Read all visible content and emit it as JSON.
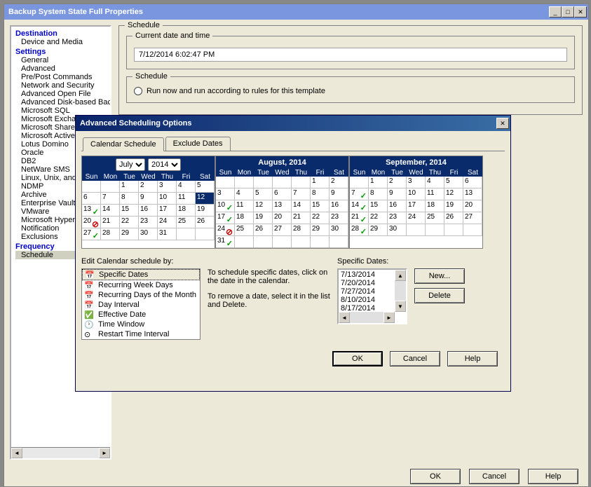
{
  "main": {
    "title": "Backup System State Full Properties",
    "groups": {
      "schedule": "Schedule",
      "datetime_label": "Current date and time",
      "datetime_value": "7/12/2014 6:02:47 PM",
      "schedule2": "Schedule",
      "radio_text": "Run now and run according to rules for this template"
    },
    "buttons": {
      "ok": "OK",
      "cancel": "Cancel",
      "help": "Help"
    }
  },
  "tree": {
    "h1": "Destination",
    "i1": "Device and Media",
    "h2": "Settings",
    "i2": "General",
    "i3": "Advanced",
    "i4": "Pre/Post Commands",
    "i5": "Network and Security",
    "i6": "Advanced Open File",
    "i7": "Advanced Disk-based Backup",
    "i8": "Microsoft SQL",
    "i9": "Microsoft Exchange",
    "i10": "Microsoft SharePoint",
    "i11": "Microsoft Active Directory",
    "i12": "Lotus Domino",
    "i13": "Oracle",
    "i14": "DB2",
    "i15": "NetWare SMS",
    "i16": "Linux, Unix, and Macintosh",
    "i17": "NDMP",
    "i18": "Archive",
    "i19": "Enterprise Vault",
    "i20": "VMware",
    "i21": "Microsoft Hyper-V",
    "i22": "Notification",
    "i23": "Exclusions",
    "h3": "Frequency",
    "i24": "Schedule"
  },
  "dialog": {
    "title": "Advanced Scheduling Options",
    "tabs": {
      "cal": "Calendar Schedule",
      "excl": "Exclude Dates"
    },
    "month_sel": "July",
    "year_sel": "2014",
    "cal2_head": "August, 2014",
    "cal3_head": "September, 2014",
    "dow": [
      "Sun",
      "Mon",
      "Tue",
      "Wed",
      "Thu",
      "Fri",
      "Sat"
    ],
    "calendars": [
      {
        "weeks": [
          [
            {
              "n": ""
            },
            {
              "n": ""
            },
            {
              "n": "1"
            },
            {
              "n": "2"
            },
            {
              "n": "3"
            },
            {
              "n": "4"
            },
            {
              "n": "5"
            }
          ],
          [
            {
              "n": "6"
            },
            {
              "n": "7"
            },
            {
              "n": "8"
            },
            {
              "n": "9"
            },
            {
              "n": "10"
            },
            {
              "n": "11"
            },
            {
              "n": "12",
              "today": true
            }
          ],
          [
            {
              "n": "13",
              "chk": true
            },
            {
              "n": "14"
            },
            {
              "n": "15"
            },
            {
              "n": "16"
            },
            {
              "n": "17"
            },
            {
              "n": "18"
            },
            {
              "n": "19"
            }
          ],
          [
            {
              "n": "20",
              "no": true
            },
            {
              "n": "21"
            },
            {
              "n": "22"
            },
            {
              "n": "23"
            },
            {
              "n": "24"
            },
            {
              "n": "25"
            },
            {
              "n": "26"
            }
          ],
          [
            {
              "n": "27",
              "chk": true
            },
            {
              "n": "28"
            },
            {
              "n": "29"
            },
            {
              "n": "30"
            },
            {
              "n": "31"
            },
            {
              "n": ""
            },
            {
              "n": ""
            }
          ]
        ]
      },
      {
        "weeks": [
          [
            {
              "n": ""
            },
            {
              "n": ""
            },
            {
              "n": ""
            },
            {
              "n": ""
            },
            {
              "n": ""
            },
            {
              "n": "1"
            },
            {
              "n": "2"
            }
          ],
          [
            {
              "n": "3"
            },
            {
              "n": "4"
            },
            {
              "n": "5"
            },
            {
              "n": "6"
            },
            {
              "n": "7"
            },
            {
              "n": "8"
            },
            {
              "n": "9"
            }
          ],
          [
            {
              "n": "10",
              "chk": true
            },
            {
              "n": "11"
            },
            {
              "n": "12"
            },
            {
              "n": "13"
            },
            {
              "n": "14"
            },
            {
              "n": "15"
            },
            {
              "n": "16"
            }
          ],
          [
            {
              "n": "17",
              "chk": true
            },
            {
              "n": "18"
            },
            {
              "n": "19"
            },
            {
              "n": "20"
            },
            {
              "n": "21"
            },
            {
              "n": "22"
            },
            {
              "n": "23"
            }
          ],
          [
            {
              "n": "24",
              "no": true
            },
            {
              "n": "25"
            },
            {
              "n": "26"
            },
            {
              "n": "27"
            },
            {
              "n": "28"
            },
            {
              "n": "29"
            },
            {
              "n": "30"
            }
          ],
          [
            {
              "n": "31",
              "chk": true
            },
            {
              "n": ""
            },
            {
              "n": ""
            },
            {
              "n": ""
            },
            {
              "n": ""
            },
            {
              "n": ""
            },
            {
              "n": ""
            }
          ]
        ]
      },
      {
        "weeks": [
          [
            {
              "n": ""
            },
            {
              "n": "1"
            },
            {
              "n": "2"
            },
            {
              "n": "3"
            },
            {
              "n": "4"
            },
            {
              "n": "5"
            },
            {
              "n": "6"
            }
          ],
          [
            {
              "n": "7",
              "chk": true
            },
            {
              "n": "8"
            },
            {
              "n": "9"
            },
            {
              "n": "10"
            },
            {
              "n": "11"
            },
            {
              "n": "12"
            },
            {
              "n": "13"
            }
          ],
          [
            {
              "n": "14",
              "chk": true
            },
            {
              "n": "15"
            },
            {
              "n": "16"
            },
            {
              "n": "17"
            },
            {
              "n": "18"
            },
            {
              "n": "19"
            },
            {
              "n": "20"
            }
          ],
          [
            {
              "n": "21",
              "chk": true
            },
            {
              "n": "22"
            },
            {
              "n": "23"
            },
            {
              "n": "24"
            },
            {
              "n": "25"
            },
            {
              "n": "26"
            },
            {
              "n": "27"
            }
          ],
          [
            {
              "n": "28",
              "chk": true
            },
            {
              "n": "29"
            },
            {
              "n": "30"
            },
            {
              "n": ""
            },
            {
              "n": ""
            },
            {
              "n": ""
            },
            {
              "n": ""
            }
          ]
        ]
      }
    ],
    "editby_label": "Edit Calendar schedule by:",
    "editby": {
      "o1": "Specific Dates",
      "o2": "Recurring Week Days",
      "o3": "Recurring Days of the Month",
      "o4": "Day Interval",
      "o5": "Effective Date",
      "o6": "Time Window",
      "o7": "Restart Time Interval"
    },
    "hint1": "To schedule specific dates, click on the date in the calendar.",
    "hint2": "To remove a date, select it in the list and Delete.",
    "spec_label": "Specific Dates:",
    "spec_dates": [
      "7/13/2014",
      "7/20/2014",
      "7/27/2014",
      "8/10/2014",
      "8/17/2014"
    ],
    "buttons": {
      "new": "New...",
      "delete": "Delete",
      "ok": "OK",
      "cancel": "Cancel",
      "help": "Help"
    }
  },
  "glyph": {
    "min": "_",
    "max": "□",
    "close": "✕",
    "check": "✓",
    "no": "⊘",
    "left": "◄",
    "right": "►",
    "up": "▲",
    "down": "▼"
  }
}
